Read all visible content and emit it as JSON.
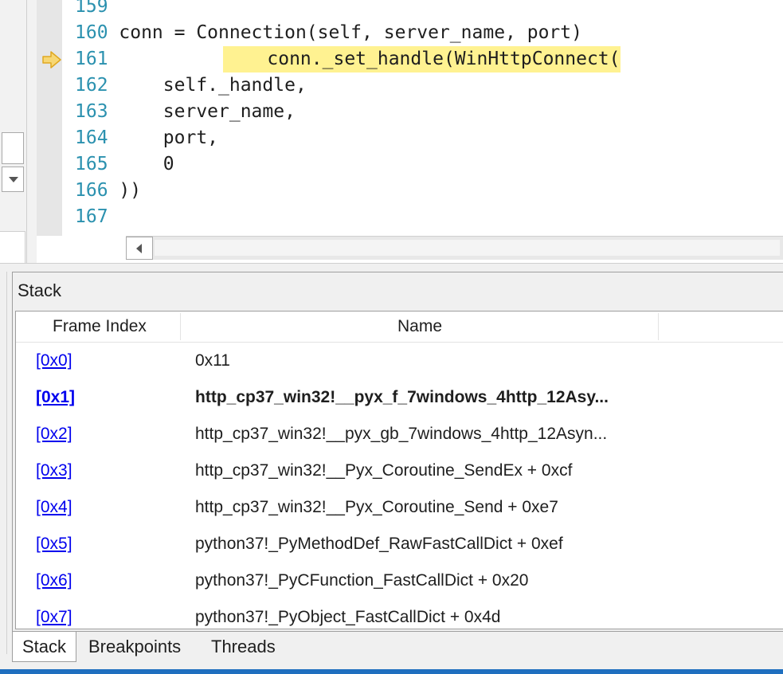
{
  "editor": {
    "lines": [
      {
        "num": "159",
        "code": "",
        "highlight": false
      },
      {
        "num": "160",
        "code": "    conn = Connection(self, server_name, port)",
        "highlight": false
      },
      {
        "num": "161",
        "code": "    conn._set_handle(WinHttpConnect(",
        "highlight": true
      },
      {
        "num": "162",
        "code": "        self._handle,",
        "highlight": false
      },
      {
        "num": "163",
        "code": "        server_name,",
        "highlight": false
      },
      {
        "num": "164",
        "code": "        port,",
        "highlight": false
      },
      {
        "num": "165",
        "code": "        0",
        "highlight": false
      },
      {
        "num": "166",
        "code": "    ))",
        "highlight": false
      },
      {
        "num": "167",
        "code": "",
        "highlight": false
      }
    ],
    "current_line_marker": "arrow-icon",
    "colors": {
      "line_number": "#2b91af",
      "highlight": "#fff291",
      "arrow": "#f2c94c"
    }
  },
  "stack_window": {
    "title": "Stack",
    "columns": [
      "Frame Index",
      "Name"
    ],
    "rows": [
      {
        "index": "[0x0]",
        "name": "0x11",
        "active": false
      },
      {
        "index": "[0x1]",
        "name": "http_cp37_win32!__pyx_f_7windows_4http_12Asy...",
        "active": true
      },
      {
        "index": "[0x2]",
        "name": "http_cp37_win32!__pyx_gb_7windows_4http_12Asyn...",
        "active": false
      },
      {
        "index": "[0x3]",
        "name": "http_cp37_win32!__Pyx_Coroutine_SendEx + 0xcf",
        "active": false
      },
      {
        "index": "[0x4]",
        "name": "http_cp37_win32!__Pyx_Coroutine_Send + 0xe7",
        "active": false
      },
      {
        "index": "[0x5]",
        "name": "python37!_PyMethodDef_RawFastCallDict + 0xef",
        "active": false
      },
      {
        "index": "[0x6]",
        "name": "python37!_PyCFunction_FastCallDict + 0x20",
        "active": false
      },
      {
        "index": "[0x7]",
        "name": "python37!_PyObject_FastCallDict + 0x4d",
        "active": false
      }
    ],
    "link_color": "#0000ee"
  },
  "tabs": [
    {
      "label": "Stack",
      "selected": true
    },
    {
      "label": "Breakpoints",
      "selected": false
    },
    {
      "label": "Threads",
      "selected": false
    }
  ]
}
